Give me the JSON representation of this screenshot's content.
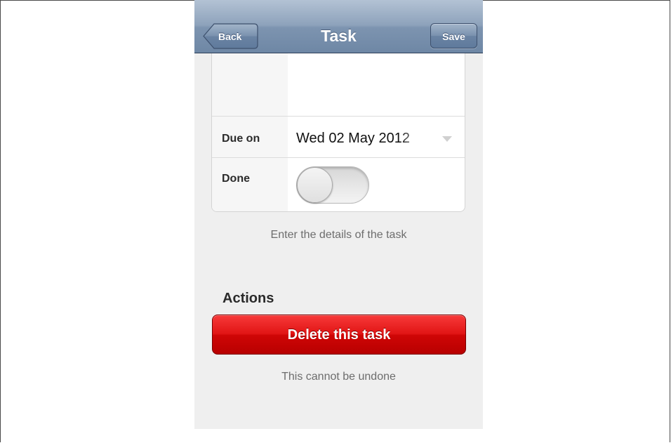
{
  "navbar": {
    "title": "Task",
    "back_label": "Back",
    "save_label": "Save"
  },
  "form": {
    "due_label": "Due on",
    "due_value": "Wed 02 May 2012",
    "done_label": "Done",
    "done_on": false,
    "hint": "Enter the details of the task"
  },
  "actions": {
    "title": "Actions",
    "delete_label": "Delete this task",
    "delete_note": "This cannot be undone"
  },
  "colors": {
    "navbar": "#7d94b0",
    "danger": "#d40808",
    "background": "#efefef"
  }
}
